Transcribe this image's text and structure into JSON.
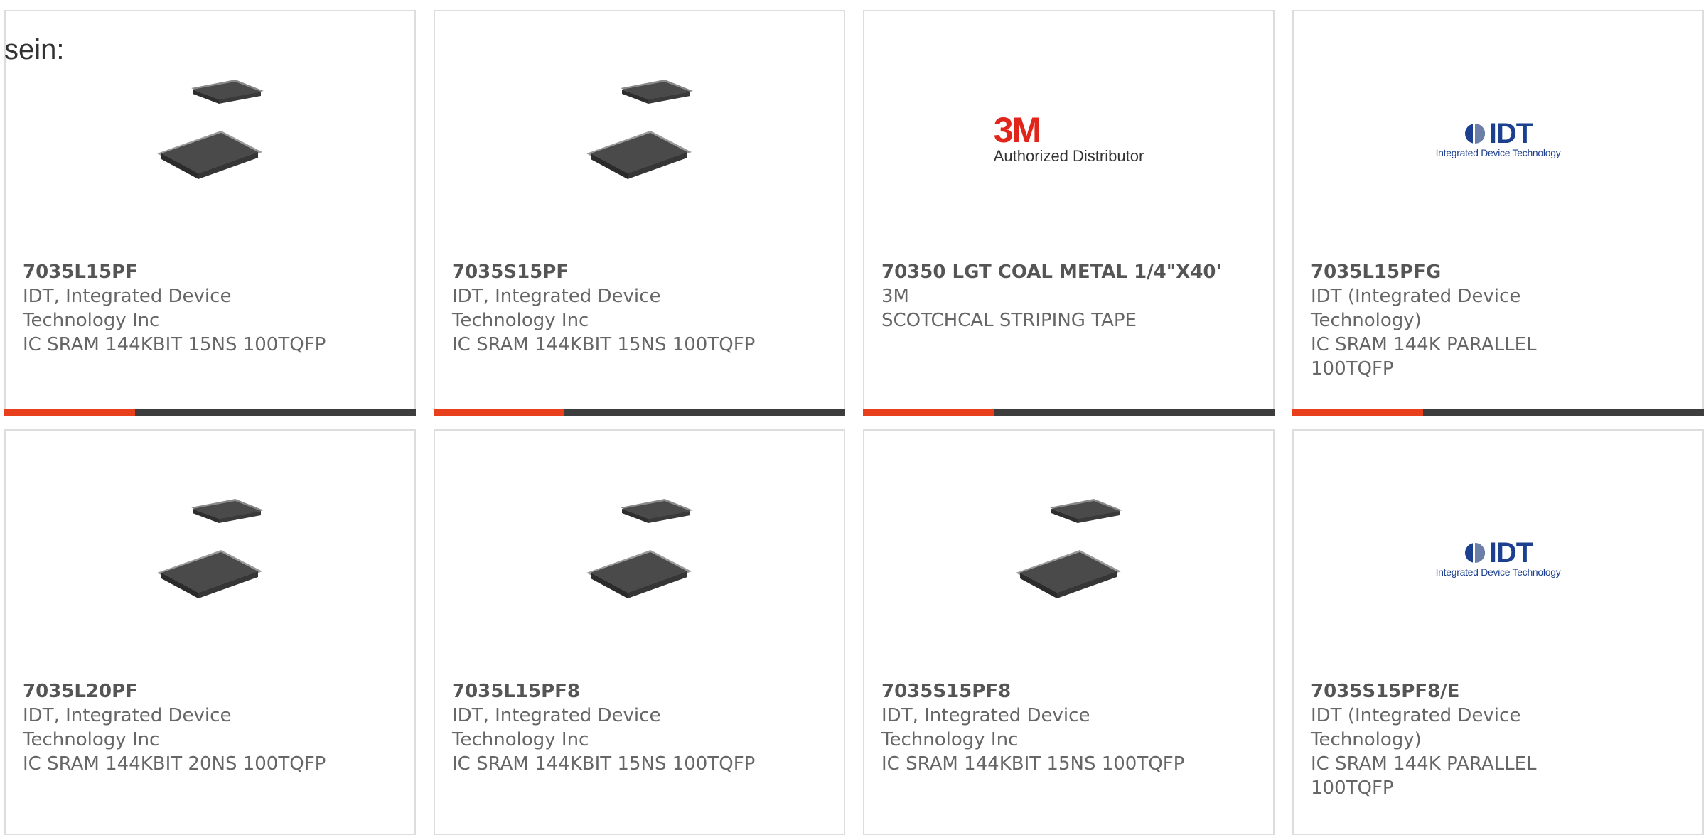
{
  "page": {
    "lead_text": "sein:"
  },
  "colors": {
    "accent": "#e8401c",
    "bar": "#3d3d3d",
    "border": "#dddddd",
    "idt_blue": "#1c3f8f",
    "brand_3m": "#e1251b"
  },
  "products": [
    {
      "image": "qfp-chip-icon",
      "part_number": "7035L15PF",
      "manufacturer": "IDT, Integrated Device Technology Inc",
      "description": "IC SRAM 144KBIT 15NS 100TQFP"
    },
    {
      "image": "qfp-chip-icon",
      "part_number": "7035S15PF",
      "manufacturer": "IDT, Integrated Device Technology Inc",
      "description": "IC SRAM 144KBIT 15NS 100TQFP"
    },
    {
      "image": "3m-logo",
      "logo_text": "3M",
      "logo_subtext": "Authorized Distributor",
      "part_number": "70350 LGT COAL METAL 1/4\"X40'",
      "manufacturer": "3M",
      "description": "SCOTCHCAL STRIPING TAPE"
    },
    {
      "image": "idt-logo",
      "logo_text": "IDT",
      "logo_subtext": "Integrated Device Technology",
      "part_number": "7035L15PFG",
      "manufacturer": "IDT (Integrated Device Technology)",
      "description": "IC SRAM 144K PARALLEL 100TQFP"
    },
    {
      "image": "qfp-chip-icon",
      "part_number": "7035L20PF",
      "manufacturer": "IDT, Integrated Device Technology Inc",
      "description": "IC SRAM 144KBIT 20NS 100TQFP"
    },
    {
      "image": "qfp-chip-icon",
      "part_number": "7035L15PF8",
      "manufacturer": "IDT, Integrated Device Technology Inc",
      "description": "IC SRAM 144KBIT 15NS 100TQFP"
    },
    {
      "image": "qfp-chip-icon",
      "part_number": "7035S15PF8",
      "manufacturer": "IDT, Integrated Device Technology Inc",
      "description": "IC SRAM 144KBIT 15NS 100TQFP"
    },
    {
      "image": "idt-logo",
      "logo_text": "IDT",
      "logo_subtext": "Integrated Device Technology",
      "part_number": "7035S15PF8/E",
      "manufacturer": "IDT (Integrated Device Technology)",
      "description": "IC SRAM 144K PARALLEL 100TQFP"
    }
  ]
}
